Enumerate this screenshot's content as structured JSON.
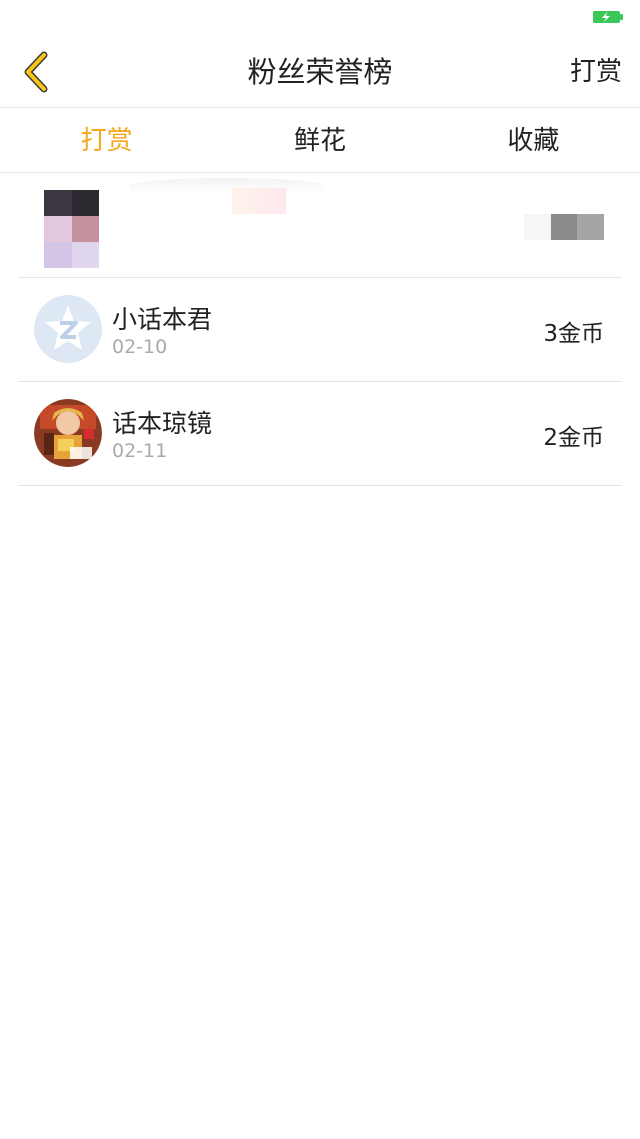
{
  "status_bar": {
    "battery_icon": "battery-charging-icon",
    "battery_color": "#3cc75a"
  },
  "nav": {
    "back_icon": "chevron-left-icon",
    "back_color": "#f5c518",
    "title": "粉丝荣誉榜",
    "action_label": "打赏"
  },
  "tabs": [
    {
      "label": "打赏",
      "active": true
    },
    {
      "label": "鲜花",
      "active": false
    },
    {
      "label": "收藏",
      "active": false
    }
  ],
  "accent_color": "#f5a623",
  "list": [
    {
      "name": "小话本君",
      "date": "02-10",
      "value": "3金币",
      "avatar_icon": "qq-star-avatar"
    },
    {
      "name": "话本琼镜",
      "date": "02-11",
      "value": "2金币",
      "avatar_icon": "illustrated-character-avatar"
    }
  ]
}
